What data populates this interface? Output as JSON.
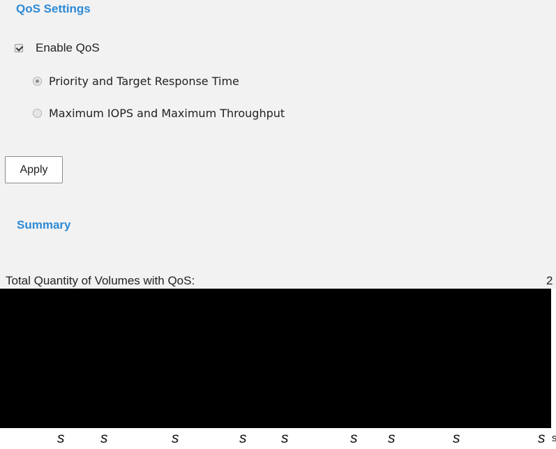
{
  "qos_settings": {
    "title": "QoS Settings",
    "enable_qos": {
      "label": "Enable QoS",
      "checked": true
    },
    "modes": [
      {
        "label": "Priority and Target Response Time",
        "selected": true
      },
      {
        "label": "Maximum IOPS and Maximum Throughput",
        "selected": false
      }
    ],
    "apply_label": "Apply"
  },
  "summary": {
    "title": "Summary",
    "total_volumes_label": "Total Quantity of Volumes with QoS:",
    "total_volumes_value": "2"
  },
  "footer": {
    "edge_mark": "s",
    "s_marks": [
      "s",
      "s",
      "s",
      "s",
      "s",
      "s",
      "s",
      "s",
      "s"
    ]
  },
  "colors": {
    "section_title": "#2d8ad6",
    "panel_background": "#f2f2f2",
    "redaction": "#000000"
  }
}
